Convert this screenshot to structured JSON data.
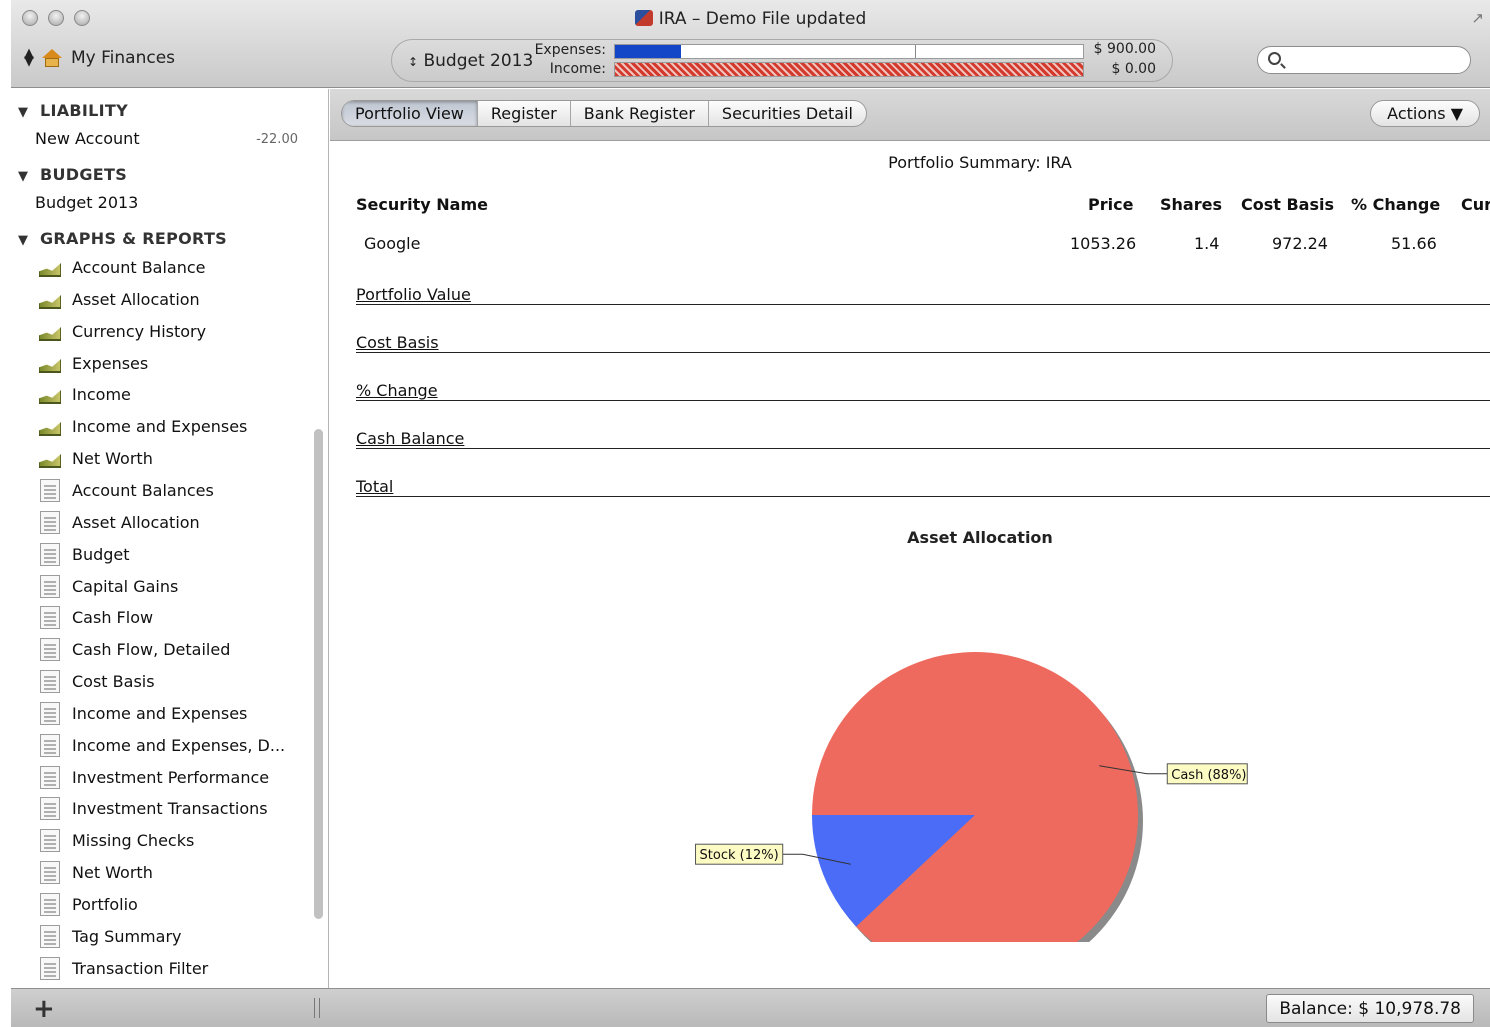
{
  "window": {
    "title": "IRA – Demo File updated"
  },
  "toolbar": {
    "file_name": "My Finances",
    "budget": {
      "name": "Budget 2013",
      "expenses_label": "Expenses:",
      "income_label": "Income:",
      "expenses_amount": "$ 900.00",
      "income_amount": "$ 0.00",
      "expenses_fill_fraction": 0.14,
      "expenses_color": "#1446c8",
      "income_color": "#d23a2e"
    },
    "search": {
      "placeholder": "",
      "value": ""
    }
  },
  "sidebar": {
    "groups": [
      {
        "label": "LIABILITY",
        "items": [
          {
            "label": "New Account",
            "amount": "-22.00"
          }
        ]
      },
      {
        "label": "BUDGETS",
        "items": [
          {
            "label": "Budget 2013"
          }
        ]
      },
      {
        "label": "GRAPHS & REPORTS"
      }
    ],
    "graphs": [
      "Account Balance",
      "Asset Allocation",
      "Currency History",
      "Expenses",
      "Income",
      "Income and Expenses",
      "Net Worth"
    ],
    "reports": [
      "Account Balances",
      "Asset Allocation",
      "Budget",
      "Capital Gains",
      "Cash Flow",
      "Cash Flow, Detailed",
      "Cost Basis",
      "Income and Expenses",
      "Income and Expenses, D...",
      "Investment Performance",
      "Investment Transactions",
      "Missing Checks",
      "Net Worth",
      "Portfolio",
      "Tag Summary",
      "Transaction Filter"
    ]
  },
  "tabs": [
    {
      "label": "Portfolio View",
      "active": true
    },
    {
      "label": "Register",
      "active": false
    },
    {
      "label": "Bank Register",
      "active": false
    },
    {
      "label": "Securities Detail",
      "active": false
    }
  ],
  "actions_label": "Actions ▼",
  "report": {
    "title": "Portfolio Summary: IRA",
    "columns": [
      "Security Name",
      "Price",
      "Shares",
      "Cost Basis",
      "% Change",
      "Cur"
    ],
    "rows": [
      {
        "name": "Google",
        "price": "1053.26",
        "shares": "1.4",
        "cost_basis": "972.24",
        "change": "51.66"
      }
    ],
    "summary_lines": [
      "Portfolio Value",
      "Cost Basis",
      "% Change",
      "Cash Balance",
      "Total"
    ]
  },
  "chart_data": {
    "type": "pie",
    "title": "Asset Allocation",
    "slices": [
      {
        "label": "Stock (12%)",
        "value": 12,
        "color": "#4a6cf7"
      },
      {
        "label": "Cash (88%)",
        "value": 88,
        "color": "#ee6a5e"
      }
    ]
  },
  "status": {
    "add_label": "+",
    "balance": "Balance: $ 10,978.78"
  }
}
